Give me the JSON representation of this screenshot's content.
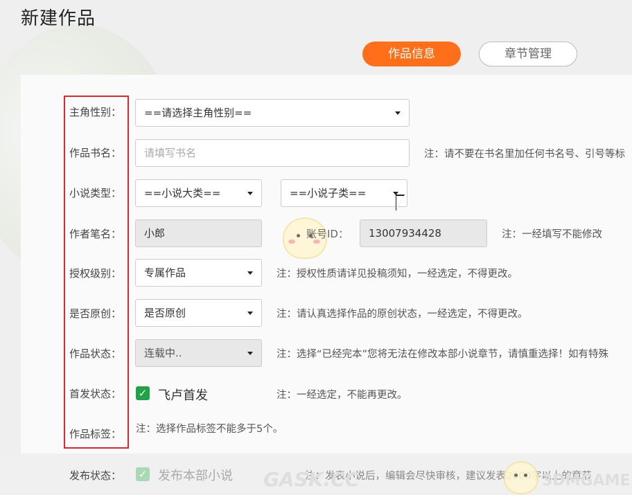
{
  "page": {
    "title": "新建作品"
  },
  "tabs": [
    {
      "label": "作品信息",
      "active": true
    },
    {
      "label": "章节管理",
      "active": false
    }
  ],
  "colors": {
    "accent": "#ff6f1a",
    "highlight": "#e0282b",
    "check": "#20a346"
  },
  "form": {
    "gender": {
      "label": "主角性别：",
      "value": "==请选择主角性别=="
    },
    "book_name": {
      "label": "作品书名：",
      "placeholder": "请填写书名",
      "note": "注：请不要在书名里加任何书名号、引号等标"
    },
    "novel_type": {
      "label": "小说类型：",
      "main_category": "==小说大类==",
      "sub_category": "==小说子类=="
    },
    "pen_name": {
      "label": "作者笔名：",
      "value": "小郎",
      "account_label": "账号ID：",
      "account_id": "13007934428",
      "note": "注：一经填写不能修改"
    },
    "license": {
      "label": "授权级别：",
      "value": "专属作品",
      "note": "注：授权性质请详见投稿须知，一经选定，不得更改。"
    },
    "original": {
      "label": "是否原创：",
      "value": "是否原创",
      "note": "注：请认真选择作品的原创状态，一经选定，不得更改。"
    },
    "status": {
      "label": "作品状态：",
      "value": "连载中..",
      "note": "注：选择“已经完本”您将无法在修改本部小说章节，请慎重选择！如有特殊"
    },
    "first_publish": {
      "label": "首发状态：",
      "checkbox_label": "飞卢首发",
      "checked": true,
      "note": "注：一经选定，不能再更改。"
    },
    "tags": {
      "label": "作品标签：",
      "note": "注：选择作品标签不能多于5个。"
    },
    "publish": {
      "label": "发布状态：",
      "checkbox_label": "发布本部小说",
      "checked": true,
      "note": "注：发表小说后，编辑会尽快审核，建议发表2000字以上的章节"
    }
  },
  "watermarks": {
    "left": "GASK.CC",
    "right": "3DMGAME"
  }
}
